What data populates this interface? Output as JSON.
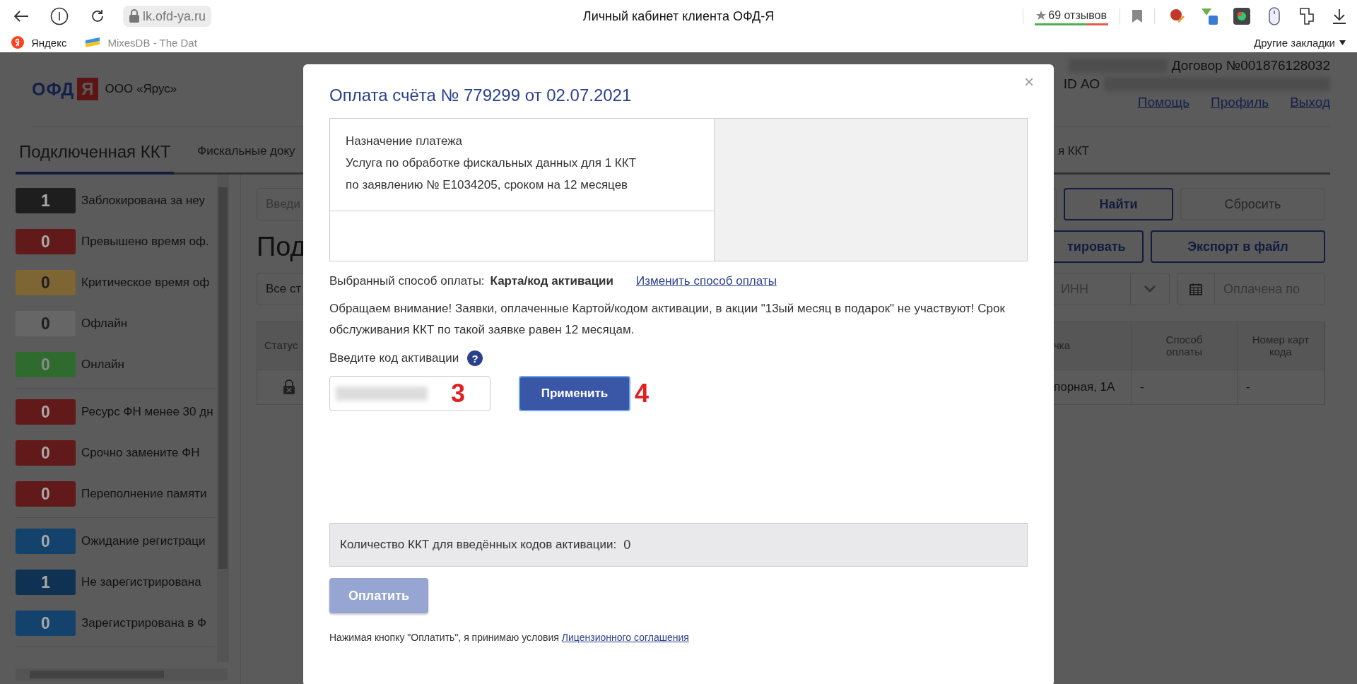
{
  "browser": {
    "address": "lk.ofd-ya.ru",
    "tab_title": "Личный кабинет клиента ОФД-Я",
    "reviews": "69 отзывов"
  },
  "bookmarks": [
    {
      "label": "Яндекс",
      "kind": "yandex"
    },
    {
      "label": "MixesDB - The Dat",
      "kind": "mixesdb"
    }
  ],
  "other_bookmarks": "Другие закладки",
  "header": {
    "logo_text": "ОФД",
    "logo_mark": "Я",
    "company": "ООО «Ярус»",
    "contract": "Договор №001876128032",
    "id_label": "ID АО",
    "links": [
      "Помощь",
      "Профиль",
      "Выход"
    ]
  },
  "tabs": [
    {
      "label": "Подключенная ККТ",
      "selected": true
    },
    {
      "label": "Фискальные доку",
      "selected": false
    },
    {
      "label": "я ККТ",
      "selected": false
    }
  ],
  "sidebar": {
    "groups": [
      {
        "items": [
          {
            "count": "1",
            "label": "Заблокирована за неу",
            "color": "#1e1e1e"
          },
          {
            "count": "0",
            "label": "Превышено время оф.",
            "color": "#611a19"
          },
          {
            "count": "0",
            "label": "Критическое время оф",
            "color": "#7d6633"
          },
          {
            "count": "0",
            "label": "Офлайн",
            "color": "#666666"
          },
          {
            "count": "0",
            "label": "Онлайн",
            "color": "#2f6b2e"
          }
        ]
      },
      {
        "items": [
          {
            "count": "0",
            "label": "Ресурс ФН менее 30 дн",
            "color": "#611a19"
          },
          {
            "count": "0",
            "label": "Срочно замените ФН",
            "color": "#611a19"
          },
          {
            "count": "0",
            "label": "Переполнение памяти",
            "color": "#611a19"
          }
        ]
      },
      {
        "items": [
          {
            "count": "0",
            "label": "Ожидание регистраци",
            "color": "#13426d"
          },
          {
            "count": "1",
            "label": "Не зарегистрирована",
            "color": "#0f3152"
          },
          {
            "count": "0",
            "label": "Зарегистрирована в Ф",
            "color": "#13426d"
          }
        ]
      }
    ]
  },
  "main": {
    "search_placeholder": "Введи",
    "find_button": "Найти",
    "reset_button": {
      "label": "Сбросить",
      "disabled": true
    },
    "heading": "Под",
    "activate_button": "тировать",
    "export_button": "Экспорт в файл",
    "status_filter": "Все ст",
    "inn_filter": "ИНН",
    "paid_until_placeholder": "Оплачена по",
    "table": {
      "columns": [
        "Статус",
        "чка",
        "Способ\nоплаты",
        "Номер карт\nкода"
      ],
      "rows": [
        {
          "locked": true,
          "address": "порная, 1А",
          "payment_method": "-",
          "card_code": "-"
        }
      ]
    }
  },
  "modal": {
    "title": "Оплата счёта № 779299 от 02.07.2021",
    "close": "×",
    "purpose_label": "Назначение платежа",
    "purpose_lines": [
      "Услуга по обработке фискальных данных для 1 ККТ",
      "по заявлению № Е1034205, сроком на 12 месяцев"
    ],
    "method_label": "Выбранный способ оплаты:",
    "method_value": "Карта/код активации",
    "change_link": "Изменить способ оплаты",
    "notice": "Обращаем внимание! Заявки, оплаченные Картой/кодом активации, в акции \"13ый месяц в подарок\" не участвуют! Срок обслуживания ККТ по такой заявке равен 12 месяцам.",
    "code_label": "Введите код активации",
    "help": "?",
    "apply_button": "Применить",
    "annotations": [
      "3",
      "4"
    ],
    "count_label": "Количество ККТ для введённых кодов активации:",
    "count_value": "0",
    "pay_button": {
      "label": "Оплатить",
      "disabled": true
    },
    "agreement_text": "Нажимая кнопку \"Оплатить\", я принимаю условия",
    "agreement_link": "Лицензионного соглашения"
  }
}
